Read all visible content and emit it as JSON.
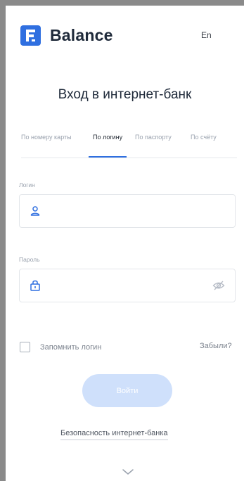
{
  "header": {
    "brand": "Balance",
    "lang": "En"
  },
  "title": "Вход в интернет-банк",
  "tabs": [
    {
      "label": "По номеру карты",
      "active": false
    },
    {
      "label": "По логину",
      "active": true
    },
    {
      "label": "По паспорту",
      "active": false
    },
    {
      "label": "По счёту",
      "active": false
    }
  ],
  "login_field": {
    "label": "Логин",
    "value": "",
    "icon": "user-icon"
  },
  "password_field": {
    "label": "Пароль",
    "value": "",
    "icon": "lock-icon",
    "toggle_icon": "eye-off-icon"
  },
  "remember": {
    "label": "Запомнить логин",
    "checked": false
  },
  "forgot_label": "Забыли?",
  "login_button": "Войти",
  "security_link": "Безопасность интернет-банка",
  "colors": {
    "accent": "#2f6fe0",
    "button_disabled": "#cfe0fb"
  }
}
